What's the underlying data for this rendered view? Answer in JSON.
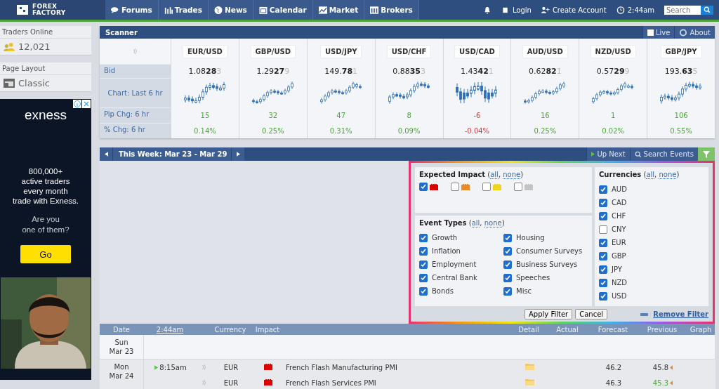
{
  "header": {
    "logo": [
      "FOREX",
      "FACTORY"
    ],
    "nav": [
      {
        "label": "Forums"
      },
      {
        "label": "Trades"
      },
      {
        "label": "News"
      },
      {
        "label": "Calendar"
      },
      {
        "label": "Market"
      },
      {
        "label": "Brokers"
      }
    ],
    "login": "Login",
    "create_account": "Create Account",
    "time": "2:44am",
    "search": {
      "placeholder": "Search"
    }
  },
  "sidebar": {
    "traders_online": {
      "title": "Traders Online",
      "count": "12,021"
    },
    "page_layout": {
      "title": "Page Layout",
      "value": "Classic"
    },
    "ad": {
      "brand": "exness",
      "headline": "800,000+\nactive traders\nevery month\ntrade with Exness.",
      "question": "Are you\none of them?",
      "button": "Go",
      "kind": "picture"
    }
  },
  "scanner": {
    "title": "Scanner",
    "live": {
      "label": "Live",
      "checked": false
    },
    "about": "About",
    "row_labels": [
      "Bid",
      "Chart: Last 6 hr",
      "Pip Chg: 6 hr",
      "% Chg: 6 hr"
    ],
    "pairs": [
      {
        "name": "EUR/USD",
        "bid": "1.08**28**",
        "pipette": "3",
        "pip_chg": "15",
        "pct_chg": "0.14%",
        "negative": false
      },
      {
        "name": "GBP/USD",
        "bid": "1.29**27**",
        "pipette": "9",
        "pip_chg": "32",
        "pct_chg": "0.25%",
        "negative": false
      },
      {
        "name": "USD/JPY",
        "bid": "149.**78**",
        "pipette": "1",
        "pip_chg": "47",
        "pct_chg": "0.31%",
        "negative": false
      },
      {
        "name": "USD/CHF",
        "bid": "0.88**35**",
        "pipette": "3",
        "pip_chg": "8",
        "pct_chg": "0.09%",
        "negative": false
      },
      {
        "name": "USD/CAD",
        "bid": "1.43**42**",
        "pipette": "1",
        "pip_chg": "-6",
        "pct_chg": "-0.04%",
        "negative": true
      },
      {
        "name": "AUD/USD",
        "bid": "0.62**82**",
        "pipette": "1",
        "pip_chg": "16",
        "pct_chg": "0.25%",
        "negative": false
      },
      {
        "name": "NZD/USD",
        "bid": "0.57**29**",
        "pipette": "9",
        "pip_chg": "1",
        "pct_chg": "0.02%",
        "negative": false
      },
      {
        "name": "GBP/JPY",
        "bid": "193.**63**",
        "pipette": "5",
        "pip_chg": "106",
        "pct_chg": "0.55%",
        "negative": false
      }
    ]
  },
  "calendar": {
    "week": "This Week: Mar 23 - Mar 29",
    "up_next": "Up Next",
    "search_events": "Search Events",
    "filter": {
      "punctuation": [
        "(",
        ", ",
        ")"
      ],
      "impact": {
        "title": "Expected Impact",
        "all": "all",
        "none": "none",
        "items": [
          {
            "color": "#dd0000",
            "checked": true
          },
          {
            "color": "#e8892a",
            "checked": false
          },
          {
            "color": "#f2d31b",
            "checked": false
          },
          {
            "color": "#c4c4c4",
            "checked": false
          }
        ]
      },
      "event_types": {
        "title": "Event Types",
        "all": "all",
        "none": "none",
        "items": [
          {
            "label": "Growth",
            "checked": true
          },
          {
            "label": "Inflation",
            "checked": true
          },
          {
            "label": "Employment",
            "checked": true
          },
          {
            "label": "Central Bank",
            "checked": true
          },
          {
            "label": "Bonds",
            "checked": true
          },
          {
            "label": "Housing",
            "checked": true
          },
          {
            "label": "Consumer Surveys",
            "checked": true
          },
          {
            "label": "Business Surveys",
            "checked": true
          },
          {
            "label": "Speeches",
            "checked": true
          },
          {
            "label": "Misc",
            "checked": true
          }
        ]
      },
      "currencies": {
        "title": "Currencies",
        "all": "all",
        "none": "none",
        "items": [
          {
            "label": "AUD",
            "checked": true
          },
          {
            "label": "CAD",
            "checked": true
          },
          {
            "label": "CHF",
            "checked": true
          },
          {
            "label": "CNY",
            "checked": false
          },
          {
            "label": "EUR",
            "checked": true
          },
          {
            "label": "GBP",
            "checked": true
          },
          {
            "label": "JPY",
            "checked": true
          },
          {
            "label": "NZD",
            "checked": true
          },
          {
            "label": "USD",
            "checked": true
          }
        ]
      },
      "apply": "Apply Filter",
      "cancel": "Cancel",
      "remove": "Remove Filter"
    },
    "columns": [
      "Date",
      "2:44am",
      "Currency",
      "Impact",
      "Detail",
      "Actual",
      "Forecast",
      "Previous",
      "Graph"
    ],
    "days": [
      {
        "date": "Sun\nMar 23"
      },
      {
        "date": "Mon\nMar 24",
        "events": [
          {
            "time": "8:15am",
            "up_next": true,
            "currency": "EUR",
            "color": "#dd0000",
            "event": "French Flash Manufacturing PMI",
            "forecast": "46.2",
            "previous": "45.8",
            "previous_better": false,
            "revised": true
          },
          {
            "currency": "EUR",
            "up_next": false,
            "color": "#dd0000",
            "event": "French Flash Services PMI",
            "forecast": "46.3",
            "previous": "45.3",
            "previous_better": true,
            "revised": true
          }
        ]
      }
    ]
  }
}
